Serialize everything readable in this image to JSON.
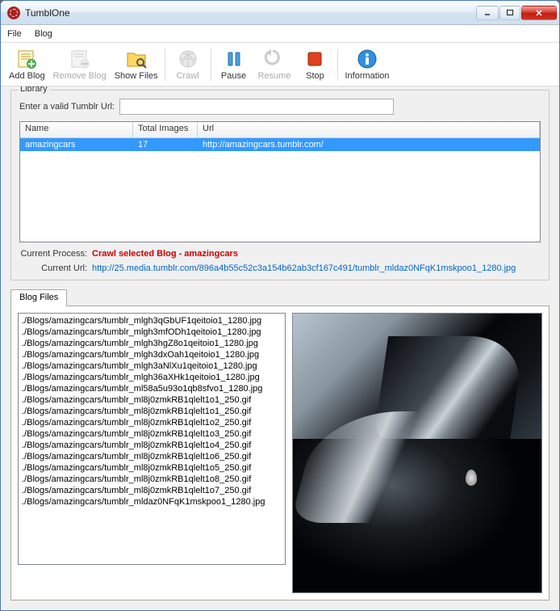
{
  "window": {
    "title": "TumblOne"
  },
  "menu": {
    "file": "File",
    "blog": "Blog"
  },
  "toolbar": {
    "add_blog": "Add Blog",
    "remove_blog": "Remove Blog",
    "show_files": "Show Files",
    "crawl": "Crawl",
    "pause": "Pause",
    "resume": "Resume",
    "stop": "Stop",
    "information": "Information"
  },
  "library": {
    "title": "Library",
    "url_label": "Enter a valid Tumblr Url:",
    "url_value": "",
    "columns": {
      "name": "Name",
      "total": "Total Images",
      "url": "Url"
    },
    "rows": [
      {
        "name": "amazingcars",
        "total": "17",
        "url": "http://amazingcars.tumblr.com/"
      }
    ],
    "process_label": "Current Process:",
    "process_value": "Crawl selected Blog - amazingcars",
    "current_url_label": "Current Url:",
    "current_url_value": "http://25.media.tumblr.com/896a4b55c52c3a154b62ab3cf167c491/tumblr_mldaz0NFqK1mskpoo1_1280.jpg"
  },
  "tabs": {
    "blog_files": "Blog Files"
  },
  "files": [
    "./Blogs/amazingcars/tumblr_mlgh3qGbUF1qeitoio1_1280.jpg",
    "./Blogs/amazingcars/tumblr_mlgh3mfODh1qeitoio1_1280.jpg",
    "./Blogs/amazingcars/tumblr_mlgh3hgZ8o1qeitoio1_1280.jpg",
    "./Blogs/amazingcars/tumblr_mlgh3dxOah1qeitoio1_1280.jpg",
    "./Blogs/amazingcars/tumblr_mlgh3aNlXu1qeitoio1_1280.jpg",
    "./Blogs/amazingcars/tumblr_mlgh36aXHk1qeitoio1_1280.jpg",
    "./Blogs/amazingcars/tumblr_ml58a5u93o1qb8sfvo1_1280.jpg",
    "./Blogs/amazingcars/tumblr_ml8j0zmkRB1qlelt1o1_250.gif",
    "./Blogs/amazingcars/tumblr_ml8j0zmkRB1qlelt1o1_250.gif",
    "./Blogs/amazingcars/tumblr_ml8j0zmkRB1qlelt1o2_250.gif",
    "./Blogs/amazingcars/tumblr_ml8j0zmkRB1qlelt1o3_250.gif",
    "./Blogs/amazingcars/tumblr_ml8j0zmkRB1qlelt1o4_250.gif",
    "./Blogs/amazingcars/tumblr_ml8j0zmkRB1qlelt1o6_250.gif",
    "./Blogs/amazingcars/tumblr_ml8j0zmkRB1qlelt1o5_250.gif",
    "./Blogs/amazingcars/tumblr_ml8j0zmkRB1qlelt1o8_250.gif",
    "./Blogs/amazingcars/tumblr_ml8j0zmkRB1qlelt1o7_250.gif",
    "./Blogs/amazingcars/tumblr_mldaz0NFqK1mskpoo1_1280.jpg"
  ]
}
